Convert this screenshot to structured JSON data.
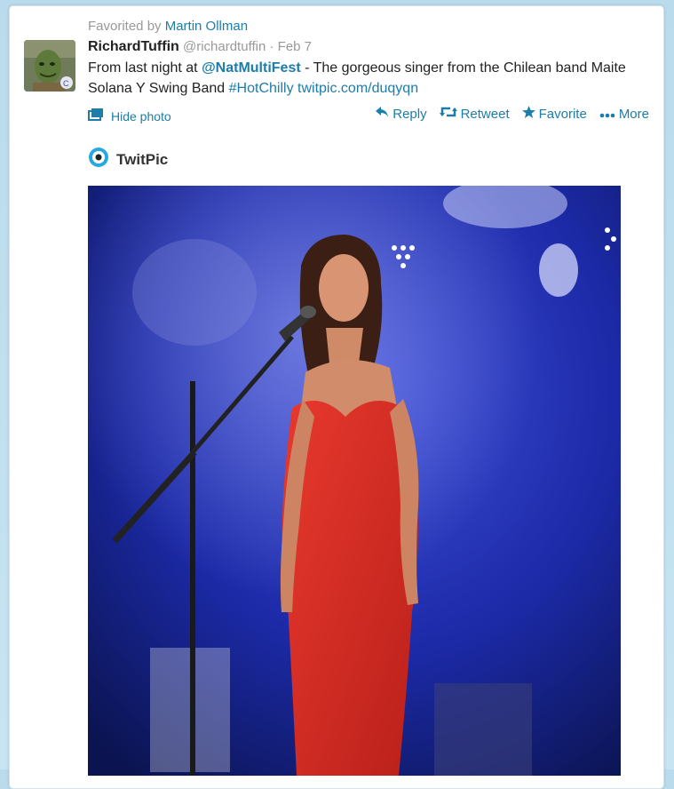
{
  "favorited": {
    "prefix": "Favorited by",
    "user": "Martin Ollman"
  },
  "tweet": {
    "name": "RichardTuffin",
    "handle": "@richardtuffin",
    "separator": "·",
    "date": "Feb 7",
    "text_part1": "From last night at",
    "mention": "@NatMultiFest",
    "text_part2": "- The gorgeous singer from the Chilean band Maite Solana Y Swing Band",
    "hashtag": "#HotChilly",
    "url": "twitpic.com/duqyqn"
  },
  "controls": {
    "hide_photo": "Hide photo",
    "reply": "Reply",
    "retweet": "Retweet",
    "favorite": "Favorite",
    "more": "More"
  },
  "media": {
    "provider": "TwitPic"
  },
  "icons": {
    "hide_photo": "photo-stack-icon",
    "reply": "reply-arrow-icon",
    "retweet": "retweet-icon",
    "favorite": "star-icon",
    "more": "dots-icon",
    "provider": "twitpic-logo-icon"
  },
  "colors": {
    "link": "#1d7da8",
    "dress": "#d62b22",
    "stage": "#1b2a9e"
  }
}
